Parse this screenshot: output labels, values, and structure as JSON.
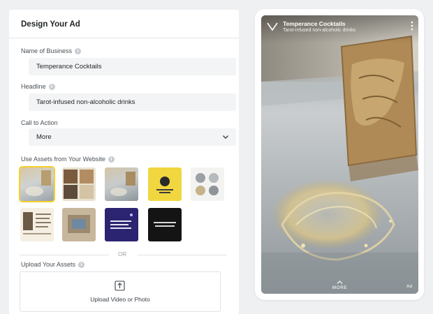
{
  "form": {
    "title": "Design Your Ad",
    "business_name": {
      "label": "Name of Business",
      "value": "Temperance Cocktails"
    },
    "headline": {
      "label": "Headline",
      "value": "Tarot-infused non-alcoholic drinks"
    },
    "call_to_action": {
      "label": "Call to Action",
      "value": "More"
    },
    "assets": {
      "label": "Use Assets from Your Website",
      "thumbnails_count_row1": 5,
      "thumbnails_count_row2": 4
    },
    "or_text": "OR",
    "upload": {
      "label": "Upload Your Assets",
      "button_label": "Upload Video or Photo"
    }
  },
  "preview": {
    "brand": "Temperance Cocktails",
    "subtitle": "Tarot-infused non-alcoholic drinks",
    "more_label": "MORE",
    "badge": "Ad"
  },
  "colors": {
    "selected_outline": "#f5d02d",
    "field_bg": "#f2f4f5",
    "page_bg": "#eef0f2"
  },
  "icons": [
    "info-icon",
    "chevron-down-icon",
    "upload-icon",
    "more-vertical-icon",
    "chevron-up-icon"
  ]
}
